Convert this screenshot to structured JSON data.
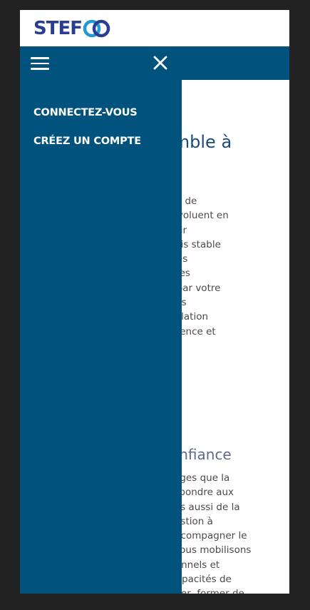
{
  "brand": {
    "logo_text": "STEF",
    "accent_color": "#02527e",
    "logo_color": "#2a3d8f",
    "logo_ring_color": "#1e9ad6"
  },
  "drawer": {
    "menu_icon": "hamburger-icon",
    "close_icon": "close-icon",
    "links": [
      {
        "label": "CONNECTEZ-VOUS"
      },
      {
        "label": "CRÉEZ UN COMPTE"
      }
    ]
  },
  "page": {
    "heading_fragment": "emble à",
    "paragraph_lines": [
      "rité, de",
      "é évoluent en",
      "uvoir",
      "a fois stable",
      "s des",
      "us les",
      "és par votre",
      "r nos",
      "e relation",
      "fficience et"
    ],
    "subheading_fragment": "confiance",
    "paragraph2_lines": [
      "llenges que la",
      "r répondre aux",
      "mais aussi de la",
      "question à",
      "r accompagner le",
      "s, nous mobilisons",
      "ssionnels et",
      "s capacités de",
      "plater, former de"
    ]
  }
}
